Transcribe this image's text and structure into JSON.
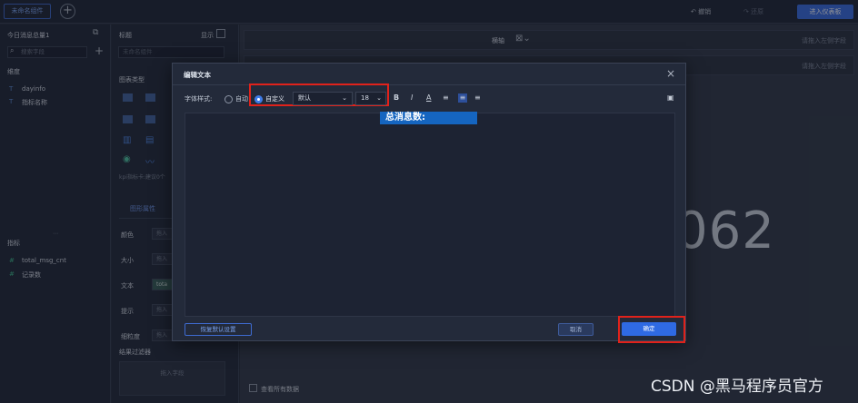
{
  "topbar": {
    "widget_tab": "未命名组件",
    "add_icon": "plus-circle-icon",
    "undo_label": "撤销",
    "redo_label": "还原",
    "dashboard_button": "进入仪表板"
  },
  "dataset_panel": {
    "title": "今日消息总量1",
    "search_placeholder": "搜索字段",
    "dimension_header": "维度",
    "dimensions": [
      "dayinfo",
      "指标名称"
    ],
    "measure_header": "指标",
    "measures": [
      "total_msg_cnt",
      "记录数"
    ]
  },
  "config_panel": {
    "title_label": "标题",
    "show_label": "显示",
    "title_placeholder": "未命名组件",
    "chart_type_label": "图表类型",
    "kpi_hint": "kpi指标卡:建议0个",
    "props_tab": "图形属性",
    "props": [
      {
        "label": "颜色",
        "value": "拖入"
      },
      {
        "label": "大小",
        "value": "拖入"
      },
      {
        "label": "文本",
        "value": "tota"
      },
      {
        "label": "提示",
        "value": "拖入"
      },
      {
        "label": "细粒度",
        "value": "拖入"
      }
    ],
    "filter_label": "结果过滤器",
    "drop_field": "拖入字段"
  },
  "canvas": {
    "axis_label": "横轴",
    "axis_placeholder_1": "请拖入左侧字段",
    "axis_placeholder_2": "请拖入左侧字段",
    "big_number": "062",
    "view_all_label": "查看所有数据"
  },
  "dialog": {
    "title": "编辑文本",
    "font_style_label": "字体样式:",
    "auto_label": "自动",
    "custom_label": "自定义",
    "font_select": "默认",
    "size_select": "18",
    "editor_text": "总消息数:",
    "reset_button": "恢复默认设置",
    "cancel_button": "取消",
    "confirm_button": "确定"
  },
  "watermark": "CSDN @黑马程序员官方"
}
